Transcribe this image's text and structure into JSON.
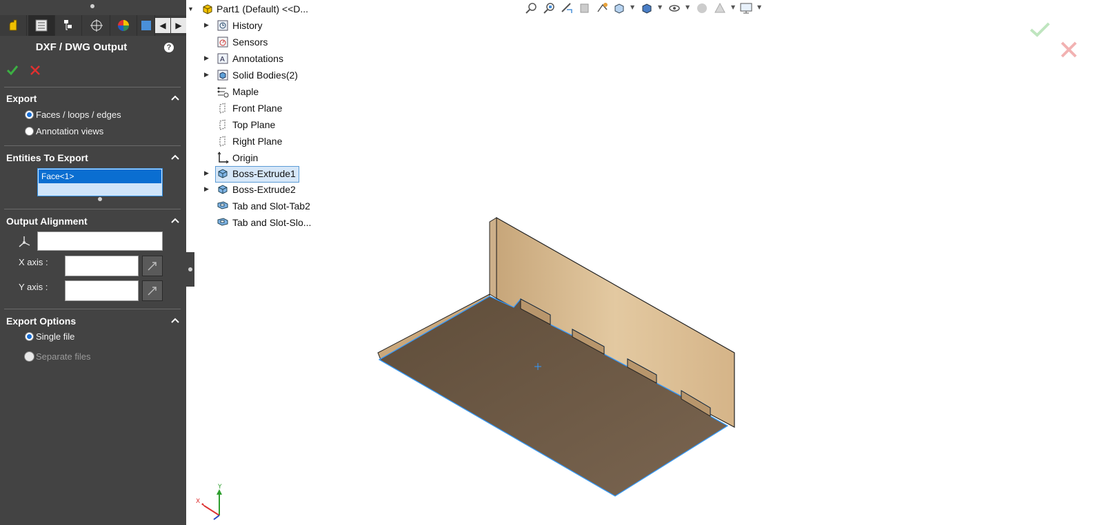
{
  "panel": {
    "title": "DXF / DWG Output",
    "tabs": [
      "feature-manager-icon",
      "property-manager-icon",
      "configuration-manager-icon",
      "dimxpert-icon",
      "display-manager-icon",
      "cam-icon"
    ],
    "sections": {
      "export": {
        "title": "Export",
        "options": [
          {
            "label": "Faces / loops / edges",
            "selected": true
          },
          {
            "label": "Annotation views",
            "selected": false
          }
        ]
      },
      "entities": {
        "title": "Entities To Export",
        "items": [
          "Face<1>"
        ]
      },
      "alignment": {
        "title": "Output Alignment",
        "x_label": "X axis :",
        "y_label": "Y axis :"
      },
      "export_options": {
        "title": "Export Options",
        "options": [
          {
            "label": "Single file",
            "selected": true
          },
          {
            "label": "Separate files",
            "selected": false,
            "disabled": true
          }
        ]
      }
    }
  },
  "tree": {
    "root": "Part1 (Default) <<D...",
    "items": [
      {
        "label": "History",
        "icon": "history-icon",
        "expandable": true
      },
      {
        "label": "Sensors",
        "icon": "sensors-icon",
        "expandable": false
      },
      {
        "label": "Annotations",
        "icon": "annotations-icon",
        "expandable": true
      },
      {
        "label": "Solid Bodies(2)",
        "icon": "solid-bodies-icon",
        "expandable": true
      },
      {
        "label": "Maple",
        "icon": "material-icon",
        "expandable": false
      },
      {
        "label": "Front Plane",
        "icon": "plane-icon",
        "expandable": false
      },
      {
        "label": "Top Plane",
        "icon": "plane-icon",
        "expandable": false
      },
      {
        "label": "Right Plane",
        "icon": "plane-icon",
        "expandable": false
      },
      {
        "label": "Origin",
        "icon": "origin-icon",
        "expandable": false
      },
      {
        "label": "Boss-Extrude1",
        "icon": "extrude-icon",
        "expandable": true,
        "selected": true
      },
      {
        "label": "Boss-Extrude2",
        "icon": "extrude-icon",
        "expandable": true
      },
      {
        "label": "Tab and Slot-Tab2",
        "icon": "tab-slot-icon",
        "expandable": false
      },
      {
        "label": "Tab and Slot-Slo...",
        "icon": "tab-slot-icon",
        "expandable": false
      }
    ]
  },
  "triad": {
    "x": "X",
    "y": "Y"
  },
  "colors": {
    "panel_bg": "#434343",
    "selection_blue": "#0a6ed1",
    "wood_light": "#d8b98c",
    "wood_dark": "#6e5a44",
    "edge_highlight": "#3399ff"
  }
}
